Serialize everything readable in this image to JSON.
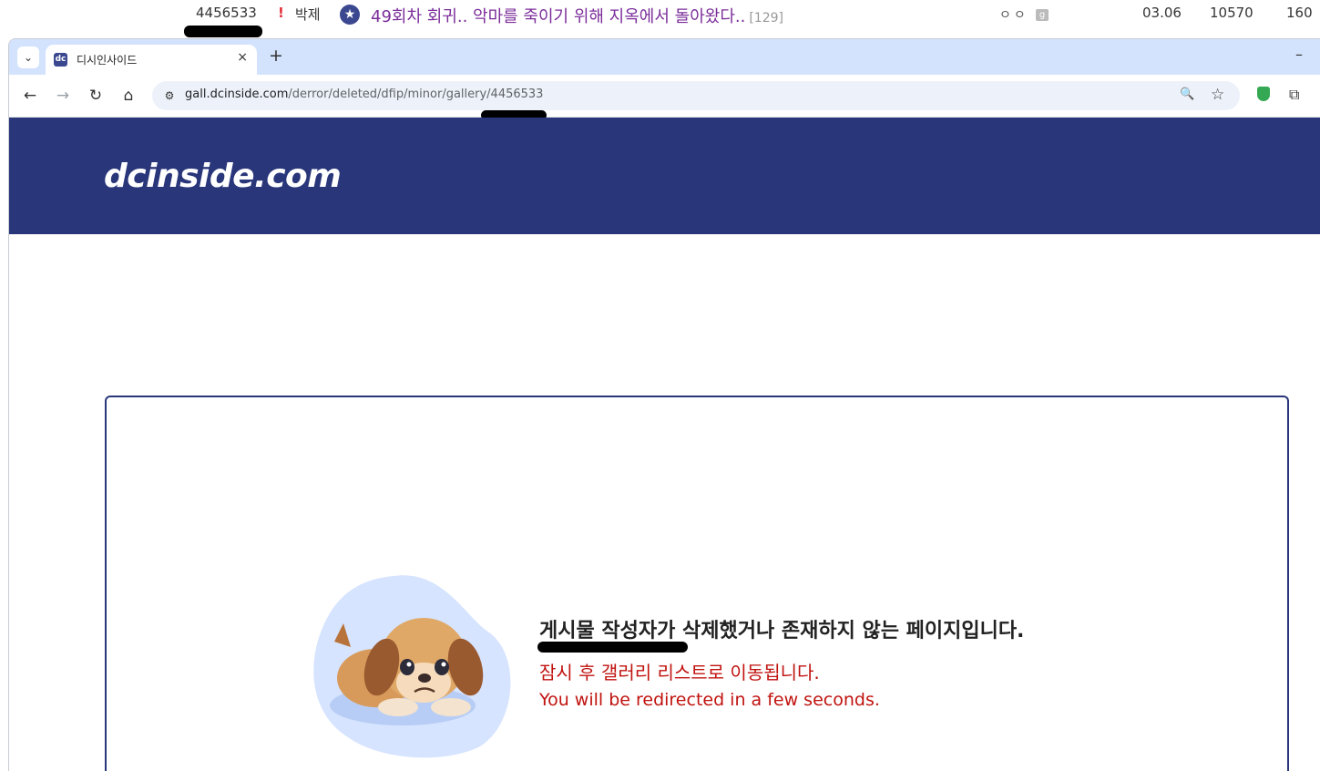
{
  "background_row": {
    "post_number": "4456533",
    "alert_mark": "!",
    "category": "박제",
    "star_icon": "star-badge-icon",
    "title": "49회차 회귀.. 악마를 죽이기 위해 지옥에서 돌아왔다..",
    "comment_count": "[129]",
    "author": "ㅇㅇ",
    "date": "03.06",
    "views": "10570",
    "recommends": "160"
  },
  "browser": {
    "tab_search_icon": "⌄",
    "tab_title": "디시인사이드",
    "tab_favicon": "dc",
    "tab_close": "×",
    "new_tab": "+",
    "minimize": "–",
    "url_domain": "gall.dcinside.com",
    "url_path": "/derror/deleted/dfip/minor/gallery/4456533",
    "back": "←",
    "forward": "→",
    "reload": "↻",
    "home": "⌂",
    "site_info": "⚙",
    "zoom": "🔍",
    "bookmark": "☆",
    "extensions": "⧉"
  },
  "site": {
    "logo": "dcinside.com",
    "brand_color": "#29367a"
  },
  "error": {
    "message": "게시물 작성자가 삭제했거나 존재하지 않는 페이지입니다.",
    "redirect_ko": "잠시 후 갤러리 리스트로 이동됩니다.",
    "redirect_en": "You will be redirected in a few seconds.",
    "alert_color": "#c0130f"
  }
}
